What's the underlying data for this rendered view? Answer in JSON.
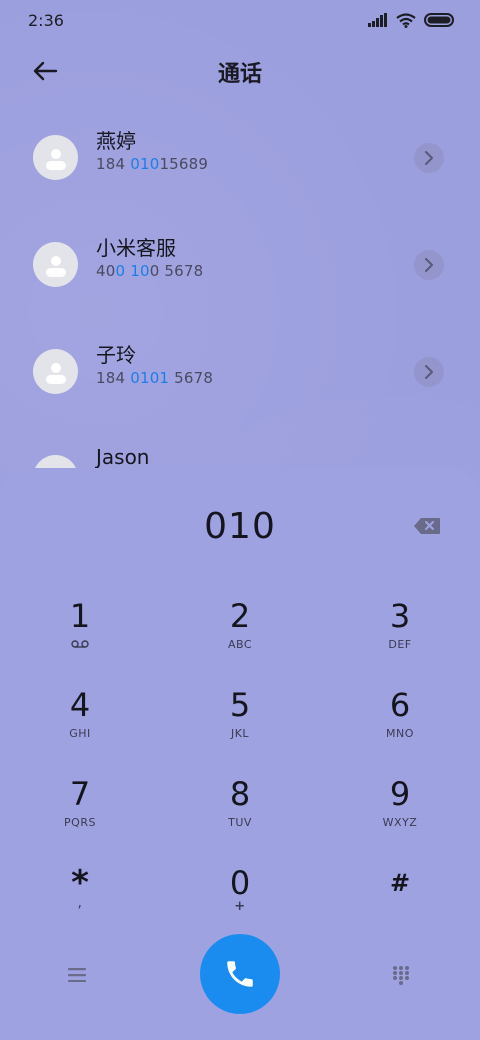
{
  "status_bar": {
    "time": "2:36"
  },
  "header": {
    "title": "通话",
    "back_icon": "arrow-left-icon"
  },
  "contacts": [
    {
      "name": "燕婷",
      "number_pre": "184 ",
      "number_hl": "010",
      "number_post": "15689"
    },
    {
      "name": "小米客服",
      "number_pre": "40",
      "number_hl": "0 10",
      "number_post": "0 5678"
    },
    {
      "name": "子玲",
      "number_pre": "184 ",
      "number_hl": "0101",
      "number_post": " 5678"
    },
    {
      "name": "Jason",
      "number_pre": "",
      "number_hl": "",
      "number_post": ""
    }
  ],
  "dialpad": {
    "dialed": "010",
    "keys": [
      {
        "digit": "1",
        "letters": ""
      },
      {
        "digit": "2",
        "letters": "ABC"
      },
      {
        "digit": "3",
        "letters": "DEF"
      },
      {
        "digit": "4",
        "letters": "GHI"
      },
      {
        "digit": "5",
        "letters": "JKL"
      },
      {
        "digit": "6",
        "letters": "MNO"
      },
      {
        "digit": "7",
        "letters": "PQRS"
      },
      {
        "digit": "8",
        "letters": "TUV"
      },
      {
        "digit": "9",
        "letters": "WXYZ"
      },
      {
        "digit": "*",
        "letters": ","
      },
      {
        "digit": "0",
        "letters": "+"
      },
      {
        "digit": "#",
        "letters": ""
      }
    ]
  },
  "colors": {
    "background": "#9c9fde",
    "sheet": "#9fa2e1",
    "accent": "#1a8cf0",
    "highlight": "#1d7ee8"
  }
}
